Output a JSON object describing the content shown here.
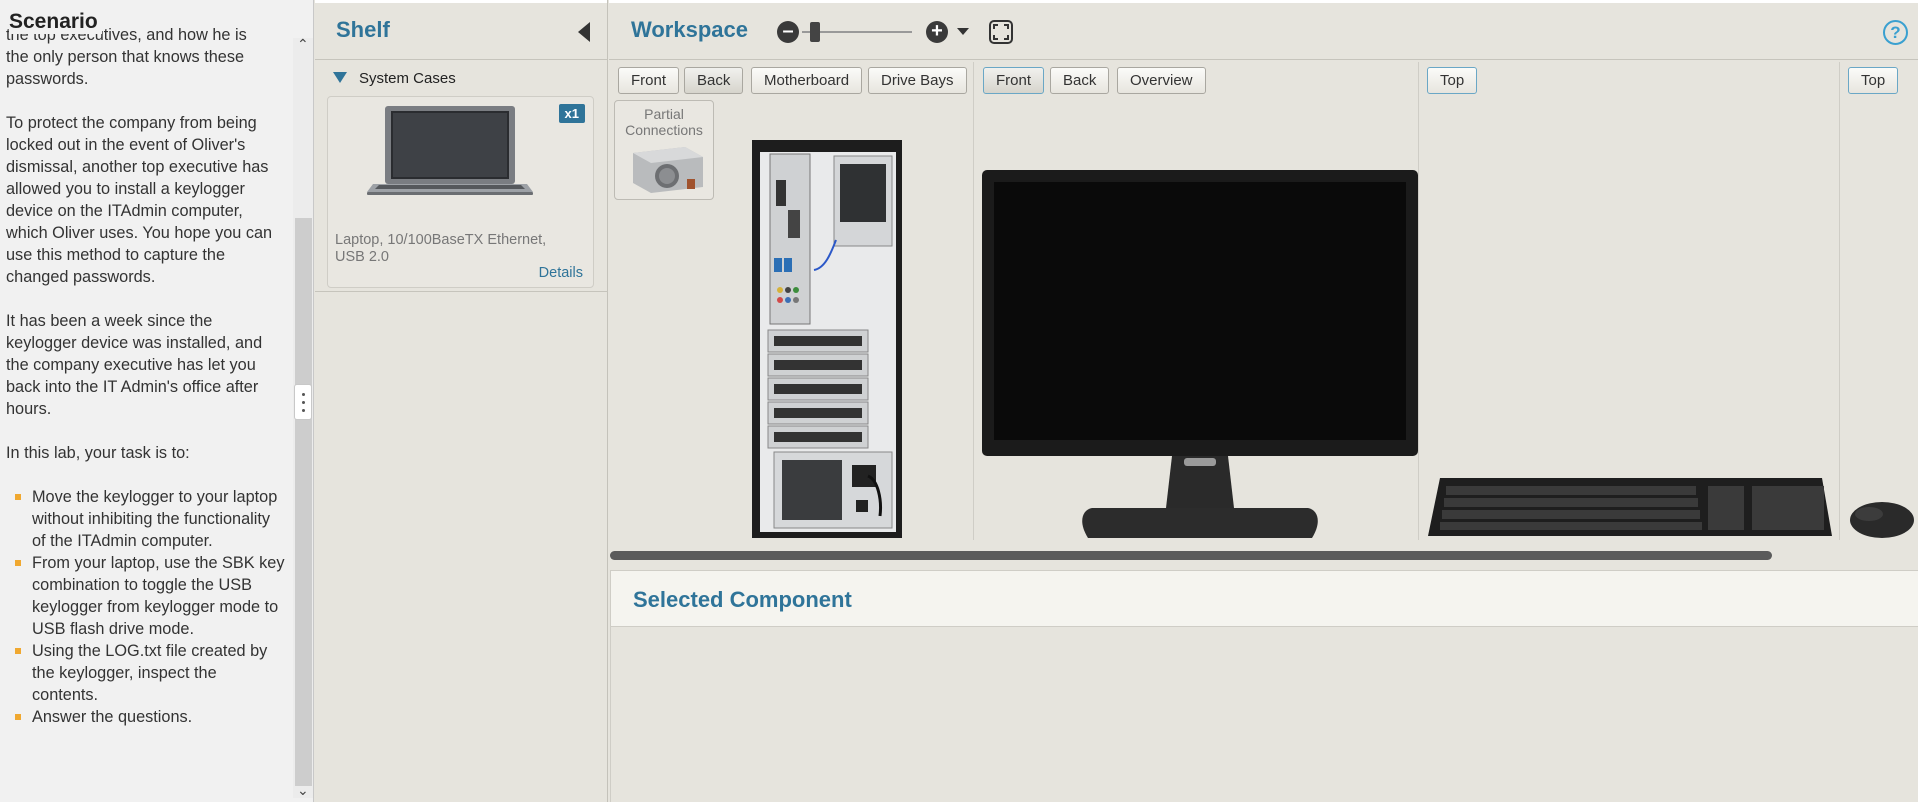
{
  "scenario": {
    "title": "Scenario",
    "cut_line": "the top executives, and how he is",
    "p1_cont": "the only person that knows these passwords.",
    "p2": "To protect the company from being locked out in the event of Oliver's dismissal, another top executive has allowed you to install a keylogger device on the ITAdmin computer, which Oliver uses. You hope you can use this method to capture the changed passwords.",
    "p3": "It has been a week since the keylogger device was installed, and the company executive has let you back into the IT Admin's office after hours.",
    "p4": "In this lab, your task is to:",
    "tasks": [
      "Move the keylogger to your laptop without inhibiting the functionality of the ITAdmin computer.",
      "From your laptop, use the SBK key combination to toggle the USB keylogger from keylogger mode to USB flash drive mode.",
      "Using the LOG.txt file created by the keylogger, inspect the contents.",
      "Answer the questions."
    ]
  },
  "shelf": {
    "title": "Shelf",
    "category": "System Cases",
    "item": {
      "qty": "x1",
      "name": "Laptop, 10/100BaseTX Ethernet, USB 2.0",
      "details": "Details"
    }
  },
  "workspace": {
    "title": "Workspace",
    "help": "?",
    "computer_tabs": [
      "Front",
      "Back",
      "Motherboard",
      "Drive Bays"
    ],
    "computer_active": "Back",
    "monitor_tabs": [
      "Front",
      "Back",
      "Overview"
    ],
    "monitor_active": "Front",
    "keyboard_tab": "Top",
    "mouse_tab": "Top",
    "partial_connections": "Partial Connections"
  },
  "selected": {
    "title": "Selected Component"
  },
  "icons": {
    "zoom_out": "minus-circle-icon",
    "zoom_in": "plus-circle-icon",
    "fullscreen": "fullscreen-icon",
    "help": "help-icon"
  },
  "colors": {
    "accent": "#2f7499",
    "bullet": "#f0a830",
    "help": "#3aa0d0"
  }
}
